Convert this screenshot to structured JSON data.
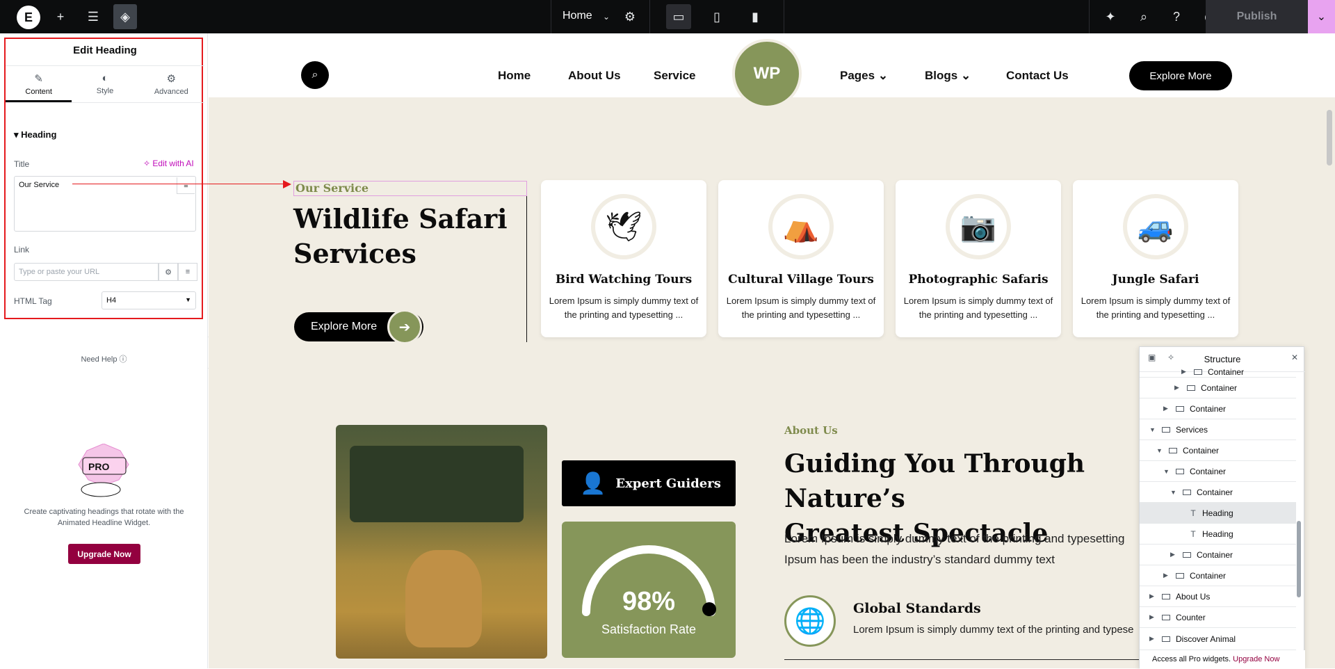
{
  "topbar": {
    "page_name": "Home",
    "publish_label": "Publish",
    "icons": [
      "elementor-logo-icon",
      "add-icon",
      "settings-sliders-icon",
      "layers-icon",
      "page-settings-gear-icon",
      "desktop-icon",
      "tablet-icon",
      "mobile-icon",
      "notifications-icon",
      "search-icon",
      "help-icon",
      "preview-eye-icon",
      "chevron-down-icon"
    ]
  },
  "panel": {
    "title": "Edit Heading",
    "tabs": [
      {
        "label": "Content",
        "icon": "pencil-icon"
      },
      {
        "label": "Style",
        "icon": "contrast-icon"
      },
      {
        "label": "Advanced",
        "icon": "gear-icon"
      }
    ],
    "section": "Heading",
    "title_label": "Title",
    "edit_ai": "Edit with AI",
    "title_value": "Our Service",
    "link_label": "Link",
    "link_placeholder": "Type or paste your URL",
    "html_tag_label": "HTML Tag",
    "html_tag_value": "H4",
    "need_help": "Need Help",
    "pro_badge": "PRO",
    "promo_text": "Create captivating headings that rotate with the Animated Headline Widget.",
    "upgrade_label": "Upgrade Now"
  },
  "site": {
    "nav": [
      "Home",
      "About Us",
      "Service",
      "Pages",
      "Blogs",
      "Contact Us"
    ],
    "logo_text": "WP",
    "explore_nav": "Explore More",
    "our_service": "Our Service",
    "title_line1": "Wildlife Safari",
    "title_line2": "Services",
    "explore_btn": "Explore More",
    "cards": [
      {
        "title": "Bird Watching Tours",
        "desc": "Lorem Ipsum is simply dummy text of the printing and typesetting ..."
      },
      {
        "title": "Cultural Village Tours",
        "desc": "Lorem Ipsum is simply dummy text of the printing and typesetting ..."
      },
      {
        "title": "Photographic Safaris",
        "desc": "Lorem Ipsum is simply dummy text of the printing and typesetting ..."
      },
      {
        "title": "Jungle Safari",
        "desc": "Lorem Ipsum is simply dummy text of the printing and typesetting ..."
      }
    ],
    "expert": "Expert Guiders",
    "satisfaction_pct": "98%",
    "satisfaction_label": "Satisfaction Rate",
    "satisfaction_value": 0.98,
    "about_small": "About Us",
    "about_title_line1": "Guiding You Through Nature’s",
    "about_title_line2": "Greatest Spectacle",
    "about_text": "Lorem Ipsum is simply dummy text of the printing and typesetting Ipsum has been the industry’s standard dummy text",
    "global_title": "Global Standards",
    "global_text": "Lorem Ipsum is simply dummy text of the printing and typese"
  },
  "structure": {
    "title": "Structure",
    "rows": [
      {
        "label": "Container",
        "type": "container",
        "collapsed": true
      },
      {
        "label": "Container",
        "type": "container",
        "collapsed": true
      },
      {
        "label": "Container",
        "type": "container",
        "collapsed": true
      },
      {
        "label": "Services",
        "type": "container",
        "collapsed": false
      },
      {
        "label": "Container",
        "type": "container",
        "collapsed": false
      },
      {
        "label": "Container",
        "type": "container",
        "collapsed": false
      },
      {
        "label": "Container",
        "type": "container",
        "collapsed": false
      },
      {
        "label": "Heading",
        "type": "text"
      },
      {
        "label": "Heading",
        "type": "text"
      },
      {
        "label": "Container",
        "type": "container",
        "collapsed": true
      },
      {
        "label": "Container",
        "type": "container",
        "collapsed": true
      },
      {
        "label": "About Us",
        "type": "container",
        "collapsed": true
      },
      {
        "label": "Counter",
        "type": "container",
        "collapsed": true
      },
      {
        "label": "Discover Animal",
        "type": "container",
        "collapsed": true
      }
    ],
    "footer_text": "Access all Pro widgets.",
    "footer_link": "Upgrade Now"
  }
}
